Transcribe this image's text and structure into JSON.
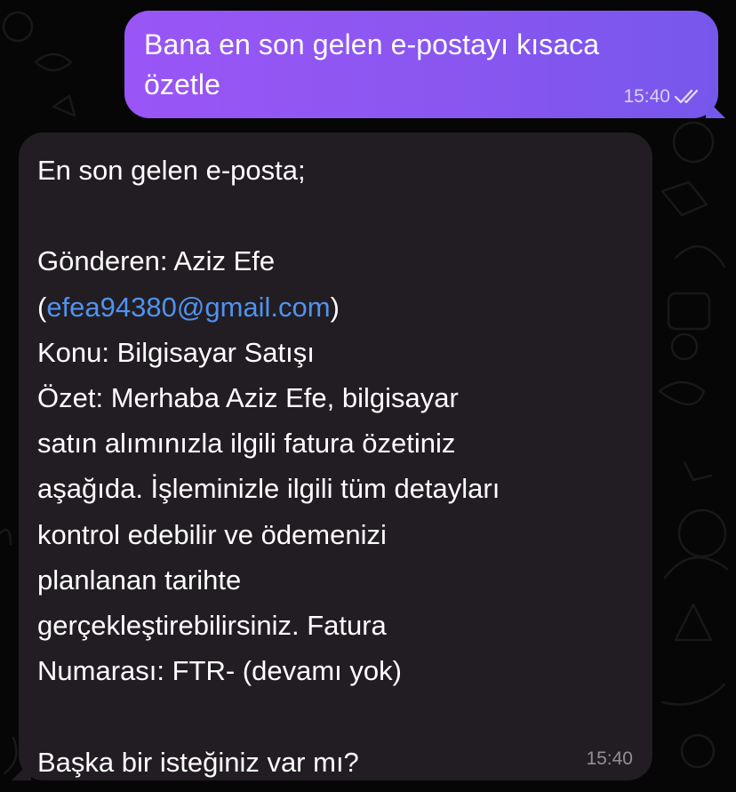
{
  "colors": {
    "background": "#060606",
    "outgoing_bubble": "#8a56f0",
    "incoming_bubble": "#221d22",
    "link": "#4f93ef"
  },
  "outgoing_message": {
    "lines": [
      "Bana en son gelen e-postayı kısaca",
      "özetle"
    ],
    "time": "15:40",
    "status_icon": "double-check-icon"
  },
  "incoming_message": {
    "line_1": "En son gelen e-posta;",
    "sender_prefix": "Gönderen: Aziz Efe",
    "sender_open": "(",
    "sender_email": "efea94380@gmail.com",
    "sender_close": ")",
    "subject": "Konu: Bilgisayar Satışı",
    "summary_lines": [
      "Özet: Merhaba Aziz Efe, bilgisayar",
      "satın alımınızla ilgili fatura özetiniz",
      "aşağıda. İşleminizle ilgili tüm detayları",
      "kontrol edebilir ve ödemenizi",
      "planlanan tarihte",
      "gerçekleştirebilirsiniz. Fatura",
      "Numarası: FTR- (devamı yok)"
    ],
    "closing": "Başka bir isteğiniz var mı?",
    "time": "15:40"
  }
}
